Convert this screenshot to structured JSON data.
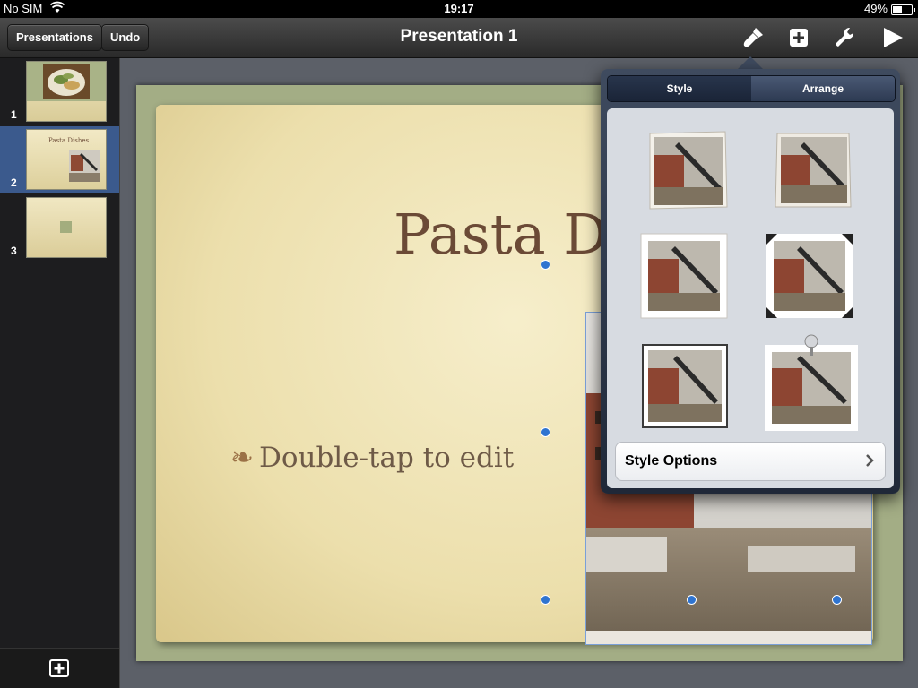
{
  "status_bar": {
    "carrier": "No SIM",
    "time": "19:17",
    "battery_pct": "49%",
    "battery_level": 0.49
  },
  "toolbar": {
    "presentations_label": "Presentations",
    "undo_label": "Undo",
    "title": "Presentation 1",
    "icons": [
      "paintbrush-icon",
      "add-icon",
      "wrench-icon",
      "play-icon"
    ]
  },
  "navigator": {
    "slides": [
      {
        "number": "1",
        "selected": false
      },
      {
        "number": "2",
        "selected": true,
        "title": "Pasta Dishes"
      },
      {
        "number": "3",
        "selected": false
      }
    ],
    "add_icon": "add-slide-icon"
  },
  "slide": {
    "title": "Pasta Dish",
    "body": "Double-tap to edit",
    "bullet_glyph": "❧"
  },
  "popover": {
    "tabs": [
      {
        "label": "Style",
        "active": true
      },
      {
        "label": "Arrange",
        "active": false
      }
    ],
    "style_options_label": "Style Options",
    "style_count": 6
  },
  "colors": {
    "selection": "#3b5a8d",
    "title_text": "#6b4a36",
    "handle": "#2f74d0"
  }
}
